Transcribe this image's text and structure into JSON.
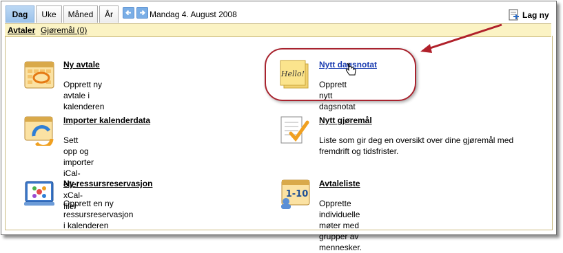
{
  "tabs": [
    {
      "label": "Dag",
      "active": true
    },
    {
      "label": "Uke",
      "active": false
    },
    {
      "label": "Måned",
      "active": false
    },
    {
      "label": "År",
      "active": false
    }
  ],
  "date_label": "Mandag 4. August 2008",
  "new_button_label": "Lag ny",
  "subnav": {
    "appointments": "Avtaler",
    "tasks": "Gjøremål (0)"
  },
  "items": {
    "new_appointment": {
      "title": "Ny avtale",
      "desc": "Opprett ny avtale i kalenderen"
    },
    "new_note": {
      "title": "Nytt dagsnotat",
      "desc": "Opprett nytt dagsnotat"
    },
    "import": {
      "title": "Importer kalenderdata",
      "desc": "Sett opp og importer iCal- eller xCal-filer"
    },
    "new_task": {
      "title": "Nytt gjøremål",
      "desc": "Liste som gir deg en oversikt over dine gjøremål med fremdrift og tidsfrister."
    },
    "resource": {
      "title": "Ny ressursreservasjon",
      "desc": "Opprett en ny ressursreservasjon i kalenderen"
    },
    "list": {
      "title": "Avtaleliste",
      "desc": "Opprette individuelle møter med grupper av mennesker."
    }
  },
  "note_icon_text": "Hello!",
  "list_icon_text": "1-10",
  "colors": {
    "active_tab": "#9ac1ea",
    "subnav_bg": "#fbf3c4",
    "highlight": "#a8232e",
    "link_blue": "#1a3cb0"
  }
}
